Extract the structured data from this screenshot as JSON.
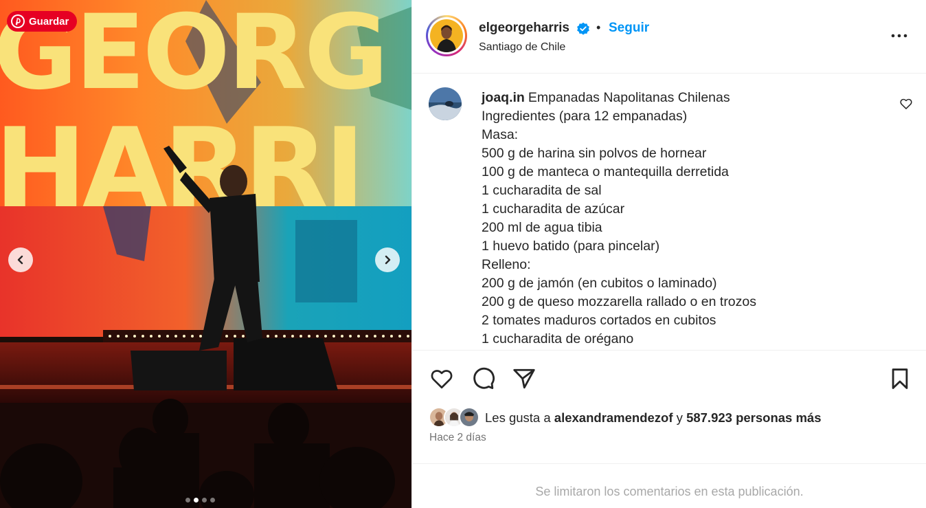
{
  "media": {
    "save_label": "Guardar",
    "backdrop_text": "GEORGE HARRIS",
    "dots_total": 4,
    "active_dot": 1
  },
  "post_header": {
    "username": "elgeorgeharris",
    "verified": true,
    "separator": "•",
    "follow_label": "Seguir",
    "location": "Santiago de Chile"
  },
  "caption": {
    "username": "joaq.in",
    "lines": [
      "Empanadas Napolitanas Chilenas",
      "Ingredientes (para 12 empanadas)",
      "Masa:",
      "500 g de harina sin polvos de hornear",
      "100 g de manteca o mantequilla derretida",
      "1 cucharadita de sal",
      "1 cucharadita de azúcar",
      "200 ml de agua tibia",
      "1 huevo batido (para pincelar)",
      "Relleno:",
      "200 g de jamón (en cubitos o laminado)",
      "200 g de queso mozzarella rallado o en trozos",
      "2 tomates maduros cortados en cubitos",
      "1 cucharadita de orégano"
    ]
  },
  "likes": {
    "prefix": "Les gusta a",
    "first_user": "alexandramendezof",
    "conjunction": "y",
    "others": "587.923 personas más",
    "time_ago": "Hace 2 días"
  },
  "comments": {
    "limited_notice": "Se limitaron los comentarios en esta publicación."
  },
  "colors": {
    "accent_blue": "#0095f6",
    "pinterest_red": "#e60023",
    "text": "#262626",
    "muted": "#737373"
  }
}
